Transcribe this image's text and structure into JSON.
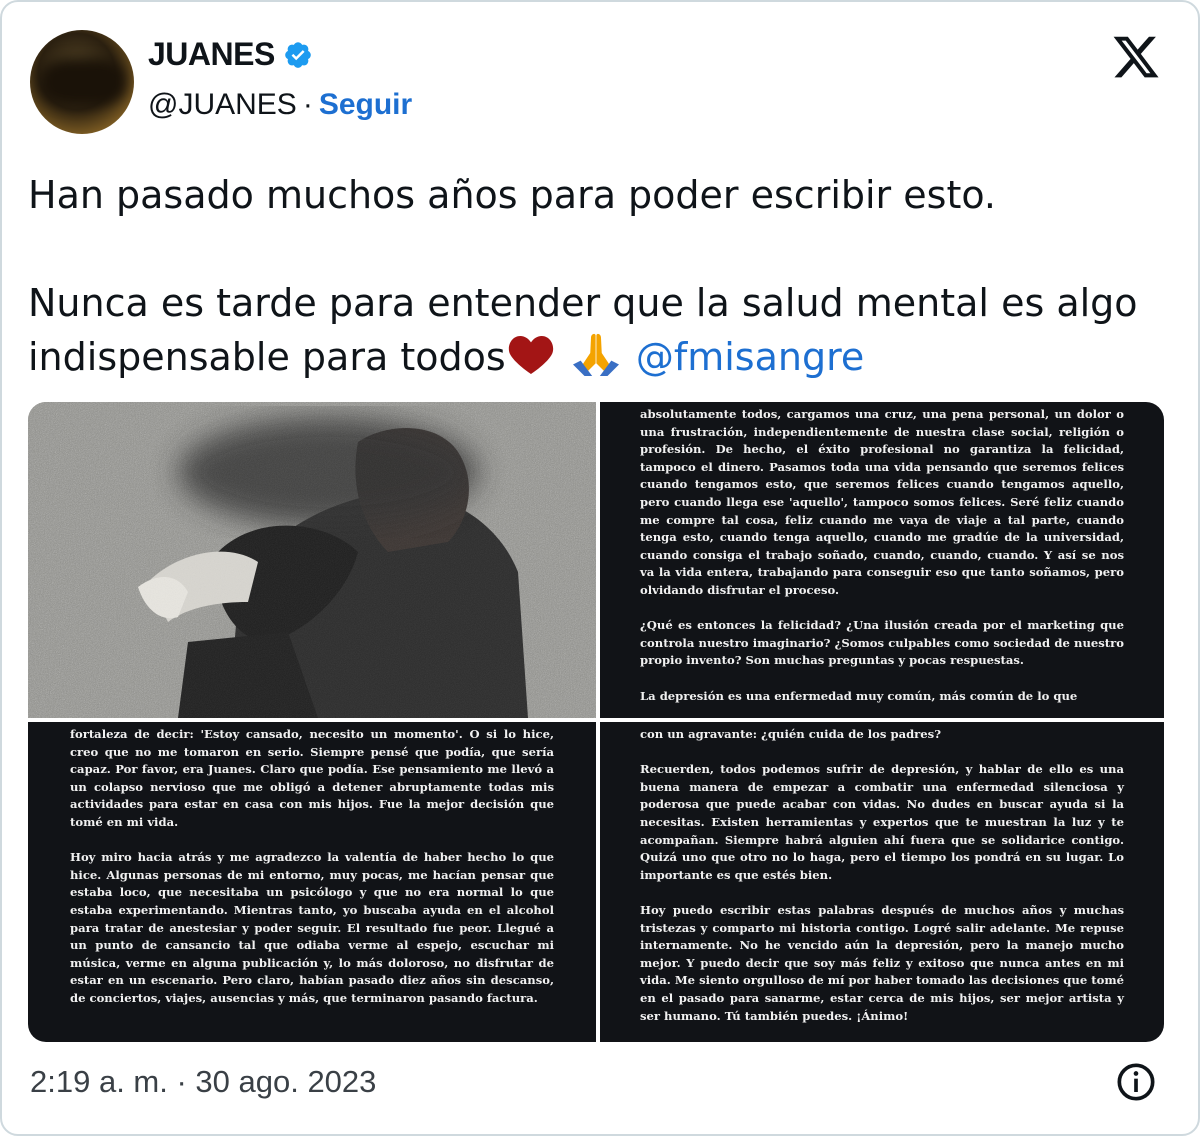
{
  "author": {
    "name": "JUANES",
    "handle": "@JUANES",
    "separator": "·",
    "follow_label": "Seguir"
  },
  "icons": {
    "verified": "verified-badge-icon",
    "platform": "x-logo-icon",
    "info": "info-icon",
    "heart": "red-heart-emoji",
    "pray": "folded-hands-emoji"
  },
  "colors": {
    "link": "#1d6fd1",
    "verified": "#1d9bf0",
    "heart": "#a31515",
    "text": "#0f1419"
  },
  "tweet": {
    "line1": "Han pasado muchos años para poder escribir esto.",
    "line2a": "Nunca es tarde para entender que la salud mental es algo",
    "line2b": "indispensable para todos",
    "mention": "@fmisangre"
  },
  "media": {
    "panel2": [
      "absolutamente todos, cargamos una cruz, una pena personal, un dolor o una frustración, independientemente de nuestra clase social, religión o profesión. De hecho, el éxito profesional no garantiza la felicidad, tampoco el dinero. Pasamos toda una vida pensando que seremos felices cuando tengamos esto, que seremos felices cuando tengamos aquello, pero cuando llega ese 'aquello', tampoco somos felices. Seré feliz cuando me compre tal cosa, feliz cuando me vaya de viaje a tal parte, cuando tenga esto, cuando tenga aquello, cuando me gradúe de la universidad, cuando consiga el trabajo soñado, cuando, cuando, cuando. Y así se nos va la vida entera, trabajando para conseguir eso que tanto soñamos, pero olvidando disfrutar el proceso.",
      "¿Qué es entonces la felicidad? ¿Una ilusión creada por el marketing que controla nuestro imaginario? ¿Somos culpables como sociedad de nuestro propio invento? Son muchas preguntas y pocas respuestas.",
      "La depresión es una enfermedad muy común, más común de lo que"
    ],
    "panel3": [
      "fortaleza de decir: 'Estoy cansado, necesito un momento'. O si lo hice, creo que no me tomaron en serio. Siempre pensé que podía, que sería capaz. Por favor, era Juanes. Claro que podía. Ese pensamiento me llevó a un colapso nervioso que me obligó a detener abruptamente todas mis actividades para estar en casa con mis hijos. Fue la mejor decisión que tomé en mi vida.",
      "Hoy miro hacia atrás y me agradezco la valentía de haber hecho lo que hice. Algunas personas de mi entorno, muy pocas, me hacían pensar que estaba loco, que necesitaba un psicólogo y que no era normal lo que estaba experimentando. Mientras tanto, yo buscaba ayuda en el alcohol para tratar de anestesiar y poder seguir. El resultado fue peor. Llegué a un punto de cansancio tal que odiaba verme al espejo, escuchar mi música, verme en alguna publicación y, lo más doloroso, no disfrutar de estar en un escenario. Pero claro, habían pasado diez años sin descanso, de conciertos, viajes, ausencias y más, que terminaron pasando factura."
    ],
    "panel4": [
      "con un agravante: ¿quién cuida de los padres?",
      "Recuerden, todos podemos sufrir de depresión, y hablar de ello es una buena manera de empezar a combatir una enfermedad silenciosa y poderosa que puede acabar con vidas. No dudes en buscar ayuda si la necesitas. Existen herramientas y expertos que te muestran la luz y te acompañan. Siempre habrá alguien ahí fuera que se solidarice contigo. Quizá uno que otro no lo haga, pero el tiempo los pondrá en su lugar. Lo importante es que estés bien.",
      "Hoy puedo escribir estas palabras después de muchos años y muchas tristezas y comparto mi historia contigo. Logré salir adelante. Me repuse internamente. No he vencido aún la depresión, pero la manejo mucho mejor. Y puedo decir que soy más feliz y exitoso que nunca antes en mi vida. Me siento orgulloso de mí por haber tomado las decisiones que tomé en el pasado para sanarme, estar cerca de mis hijos, ser mejor artista y ser humano. Tú también puedes. ¡Ánimo!"
    ]
  },
  "footer": {
    "timestamp": "2:19 a. m. · 30 ago. 2023"
  }
}
